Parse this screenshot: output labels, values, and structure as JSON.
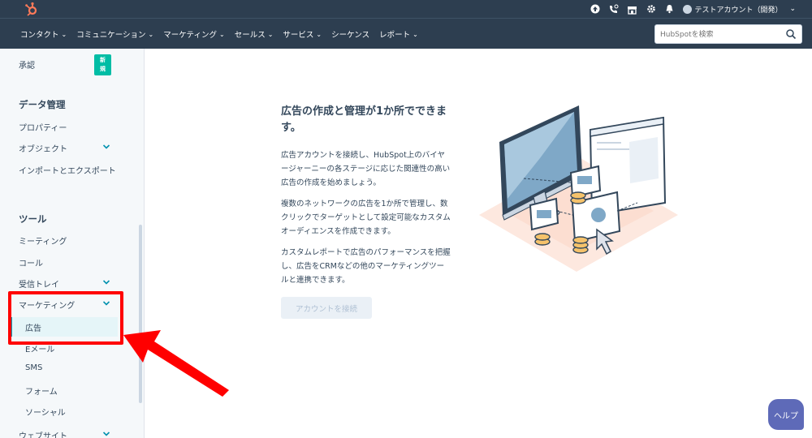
{
  "topbar": {
    "account_label": "テストアカウント（開発）"
  },
  "navbar": {
    "items": [
      {
        "label": "コンタクト",
        "has_menu": true
      },
      {
        "label": "コミュニケーション",
        "has_menu": true
      },
      {
        "label": "マーケティング",
        "has_menu": true
      },
      {
        "label": "セールス",
        "has_menu": true
      },
      {
        "label": "サービス",
        "has_menu": true
      },
      {
        "label": "シーケンス",
        "has_menu": false
      },
      {
        "label": "レポート",
        "has_menu": true
      }
    ],
    "search_placeholder": "HubSpotを検索"
  },
  "sidebar": {
    "approval_label": "承認",
    "new_badge": "新\n規",
    "data_heading": "データ管理",
    "properties": "プロパティー",
    "objects": "オブジェクト",
    "import_export": "インポートとエクスポート",
    "tools_heading": "ツール",
    "meetings": "ミーティング",
    "calls": "コール",
    "inbox": "受信トレイ",
    "marketing": "マーケティング",
    "ads": "広告",
    "email": "Eメール",
    "sms": "SMS",
    "forms": "フォーム",
    "social": "ソーシャル",
    "website": "ウェブサイト"
  },
  "main": {
    "title": "広告の作成と管理が1か所でできます。",
    "para1": "広告アカウントを接続し、HubSpot上のバイヤージャーニーの各ステージに応じた関連性の高い広告の作成を始めましょう。",
    "para2": "複数のネットワークの広告を1か所で管理し、数クリックでターゲットとして設定可能なカスタムオーディエンスを作成できます。",
    "para3": "カスタムレポートで広告のパフォーマンスを把握し、広告をCRMなどの他のマーケティングツールと連携できます。",
    "connect_button": "アカウントを接続"
  },
  "help_button": "ヘルプ",
  "colors": {
    "nav_bg": "#2d3e50",
    "accent_teal": "#00bda5",
    "active_border": "#00a4bd",
    "annotation_red": "#ff0000",
    "help_bg": "#5e6ab8"
  }
}
